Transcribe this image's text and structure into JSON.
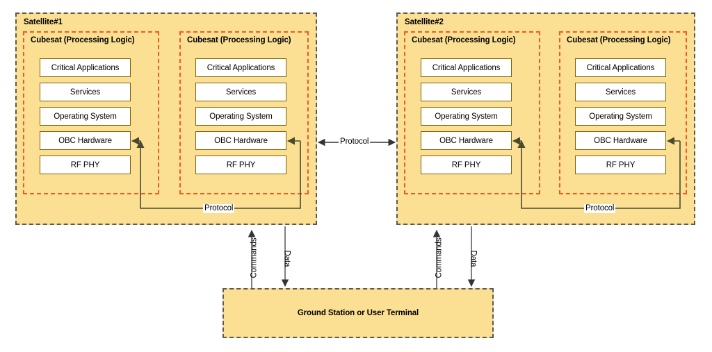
{
  "diagram": {
    "title": "Satellite constellation architecture with ground station",
    "colors": {
      "satellite_fill": "#fbdf92",
      "satellite_border": "#595959",
      "cubesat_border": "#ed5c24",
      "layer_border": "#7f6000",
      "layer_fill": "#ffffff",
      "connector": "#595959",
      "protocol_internal": "#7f6000",
      "page_background": "#ffffff"
    }
  },
  "satellites": [
    {
      "id": "satellite-1",
      "title": "Satellite#1",
      "cubesats": [
        {
          "id": "sat1-cubesat-left",
          "title": "Cubesat  (Processing Logic)",
          "layers": [
            "Critical Applications",
            "Services",
            "Operating System",
            "OBC Hardware",
            "RF PHY"
          ]
        },
        {
          "id": "sat1-cubesat-right",
          "title": "Cubesat  (Processing Logic)",
          "layers": [
            "Critical Applications",
            "Services",
            "Operating System",
            "OBC Hardware",
            "RF PHY"
          ]
        }
      ],
      "internal_link_label": "Protocol",
      "uplink_label": "Commands",
      "downlink_label": "Data"
    },
    {
      "id": "satellite-2",
      "title": "Satellite#2",
      "cubesats": [
        {
          "id": "sat2-cubesat-left",
          "title": "Cubesat  (Processing Logic)",
          "layers": [
            "Critical Applications",
            "Services",
            "Operating System",
            "OBC Hardware",
            "RF PHY"
          ]
        },
        {
          "id": "sat2-cubesat-right",
          "title": "Cubesat  (Processing Logic)",
          "layers": [
            "Critical Applications",
            "Services",
            "Operating System",
            "OBC Hardware",
            "RF PHY"
          ]
        }
      ],
      "internal_link_label": "Protocol",
      "uplink_label": "Commands",
      "downlink_label": "Data"
    }
  ],
  "inter_satellite_link": {
    "label": "Protocol",
    "direction": "bidirectional"
  },
  "ground_station": {
    "label": "Ground Station or User Terminal"
  }
}
